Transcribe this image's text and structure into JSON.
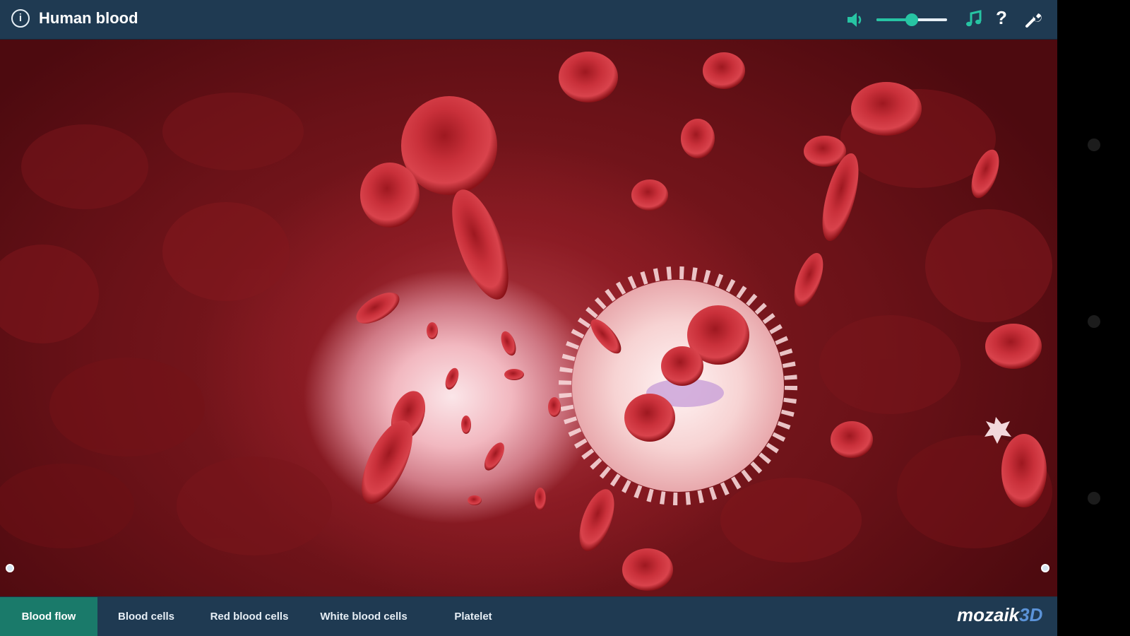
{
  "header": {
    "title": "Human blood",
    "info_icon": "info-icon",
    "volume_icon": "speaker-icon",
    "volume_level": 0.5,
    "music_icon": "music-note-icon",
    "help_icon": "help-icon",
    "help_glyph": "?",
    "settings_icon": "wrench-icon",
    "accent_color": "#27c4a3"
  },
  "scene": {
    "description_icon": "blood-vessel-3d-scene"
  },
  "tabs": [
    {
      "label": "Blood flow",
      "active": true
    },
    {
      "label": "Blood cells",
      "active": false
    },
    {
      "label": "Red blood cells",
      "active": false
    },
    {
      "label": "White blood cells",
      "active": false
    },
    {
      "label": "Platelet",
      "active": false
    }
  ],
  "brand": {
    "part1": "mozaik",
    "part2": "3D"
  },
  "colors": {
    "bar_bg": "#1f3a52",
    "active_tab": "#1a7a6a",
    "blood_red": "#b01e28"
  }
}
